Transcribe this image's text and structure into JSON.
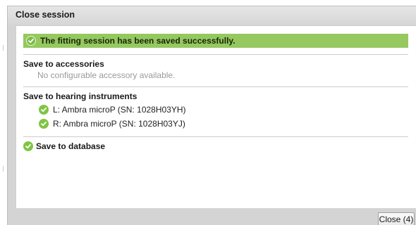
{
  "dialog": {
    "title": "Close session",
    "banner": "The fitting session has been saved successfully.",
    "accessories": {
      "title": "Save to accessories",
      "message": "No configurable accessory available."
    },
    "hearing_instruments": {
      "title": "Save to hearing instruments",
      "items": [
        "L: Ambra microP (SN: 1028H03YH)",
        "R: Ambra microP (SN: 1028H03YJ)"
      ]
    },
    "database": {
      "title": "Save to database"
    },
    "close_button": "Close (4)"
  },
  "colors": {
    "banner": "#95c85f",
    "check": "#80c444",
    "muted_text": "#9a9a9a"
  },
  "icons": {
    "status": "check-circle-icon"
  }
}
